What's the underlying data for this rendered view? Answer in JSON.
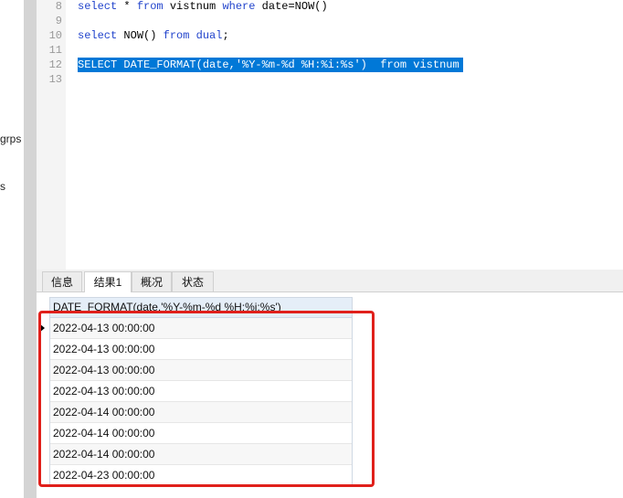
{
  "left_panel": {
    "items": [
      "grps",
      "s"
    ]
  },
  "editor": {
    "lines": [
      {
        "num": "8",
        "tokens": [
          {
            "t": "select",
            "kw": true
          },
          {
            "t": " * ",
            "kw": false
          },
          {
            "t": "from",
            "kw": true
          },
          {
            "t": " vistnum ",
            "kw": false
          },
          {
            "t": "where",
            "kw": true
          },
          {
            "t": " date=NOW()",
            "kw": false
          }
        ]
      },
      {
        "num": "9",
        "tokens": []
      },
      {
        "num": "10",
        "tokens": [
          {
            "t": "select",
            "kw": true
          },
          {
            "t": " NOW() ",
            "kw": false
          },
          {
            "t": "from",
            "kw": true
          },
          {
            "t": " ",
            "kw": false
          },
          {
            "t": "dual",
            "kw": true
          },
          {
            "t": ";",
            "kw": false
          }
        ]
      },
      {
        "num": "11",
        "tokens": []
      },
      {
        "num": "12",
        "selected": true,
        "tokens": [
          {
            "t": "SELECT DATE_FORMAT(date,'%Y-%m-%d %H:%i:%s')  from vistnum",
            "kw": false
          }
        ]
      },
      {
        "num": "13",
        "tokens": []
      }
    ]
  },
  "tabs": [
    {
      "label": "信息",
      "active": false
    },
    {
      "label": "结果1",
      "active": true
    },
    {
      "label": "概况",
      "active": false
    },
    {
      "label": "状态",
      "active": false
    }
  ],
  "result_grid": {
    "column": "DATE_FORMAT(date,'%Y-%m-%d %H:%i:%s')",
    "rows": [
      "2022-04-13 00:00:00",
      "2022-04-13 00:00:00",
      "2022-04-13 00:00:00",
      "2022-04-13 00:00:00",
      "2022-04-14 00:00:00",
      "2022-04-14 00:00:00",
      "2022-04-14 00:00:00",
      "2022-04-23 00:00:00"
    ],
    "current_row": 0
  },
  "colors": {
    "keyword": "#2244cc",
    "selection": "#0078d7",
    "annotation_box": "#e0201b"
  }
}
